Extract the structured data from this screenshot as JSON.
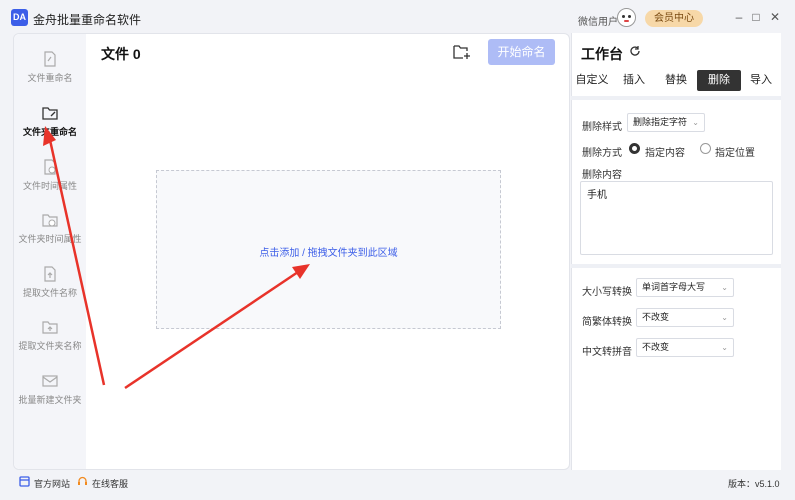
{
  "window": {
    "app_title": "金舟批量重命名软件",
    "logo_text": "DA",
    "user_label": "微信用户",
    "member_label": "会员中心",
    "minimize": "–",
    "maximize": "□",
    "close": "✕"
  },
  "sidebar": {
    "items": [
      {
        "label": "文件重命名",
        "icon": "file-icon",
        "active": false
      },
      {
        "label": "文件夹重命名",
        "icon": "folder-edit-icon",
        "active": true
      },
      {
        "label": "文件时间属性",
        "icon": "file-clock-icon",
        "active": false
      },
      {
        "label": "文件夹时间属性",
        "icon": "folder-clock-icon",
        "active": false
      },
      {
        "label": "提取文件名称",
        "icon": "file-upload-icon",
        "active": false
      },
      {
        "label": "提取文件夹名称",
        "icon": "folder-upload-icon",
        "active": false
      },
      {
        "label": "批量新建文件夹",
        "icon": "folder-new-icon",
        "active": false
      }
    ]
  },
  "main": {
    "title": "文件 0",
    "start_button": "开始命名",
    "drop_add": "点击添加",
    "drop_sep": " / ",
    "drop_drag": "拖拽文件夹到此区域"
  },
  "workspace": {
    "title": "工作台",
    "tabs": [
      "自定义",
      "插入",
      "替换",
      "删除",
      "导入"
    ],
    "active_tab": "删除",
    "delete_style_label": "删除样式",
    "delete_style_value": "删除指定字符",
    "delete_mode_label": "删除方式",
    "mode_content": "指定内容",
    "mode_position": "指定位置",
    "selected_mode": "指定内容",
    "delete_content_label": "删除内容",
    "delete_content_value": "手机",
    "case_label": "大小写转换",
    "case_value": "单词首字母大写",
    "trad_label": "简繁体转换",
    "trad_value": "不改变",
    "pinyin_label": "中文转拼音",
    "pinyin_value": "不改变"
  },
  "statusbar": {
    "website": "官方网站",
    "support": "在线客服",
    "version": "版本：v5.1.0"
  },
  "colors": {
    "accent": "#3c5ee8",
    "start_button": "#aebcf6",
    "arrow": "#e8332a",
    "member": "#f7d8a8"
  }
}
